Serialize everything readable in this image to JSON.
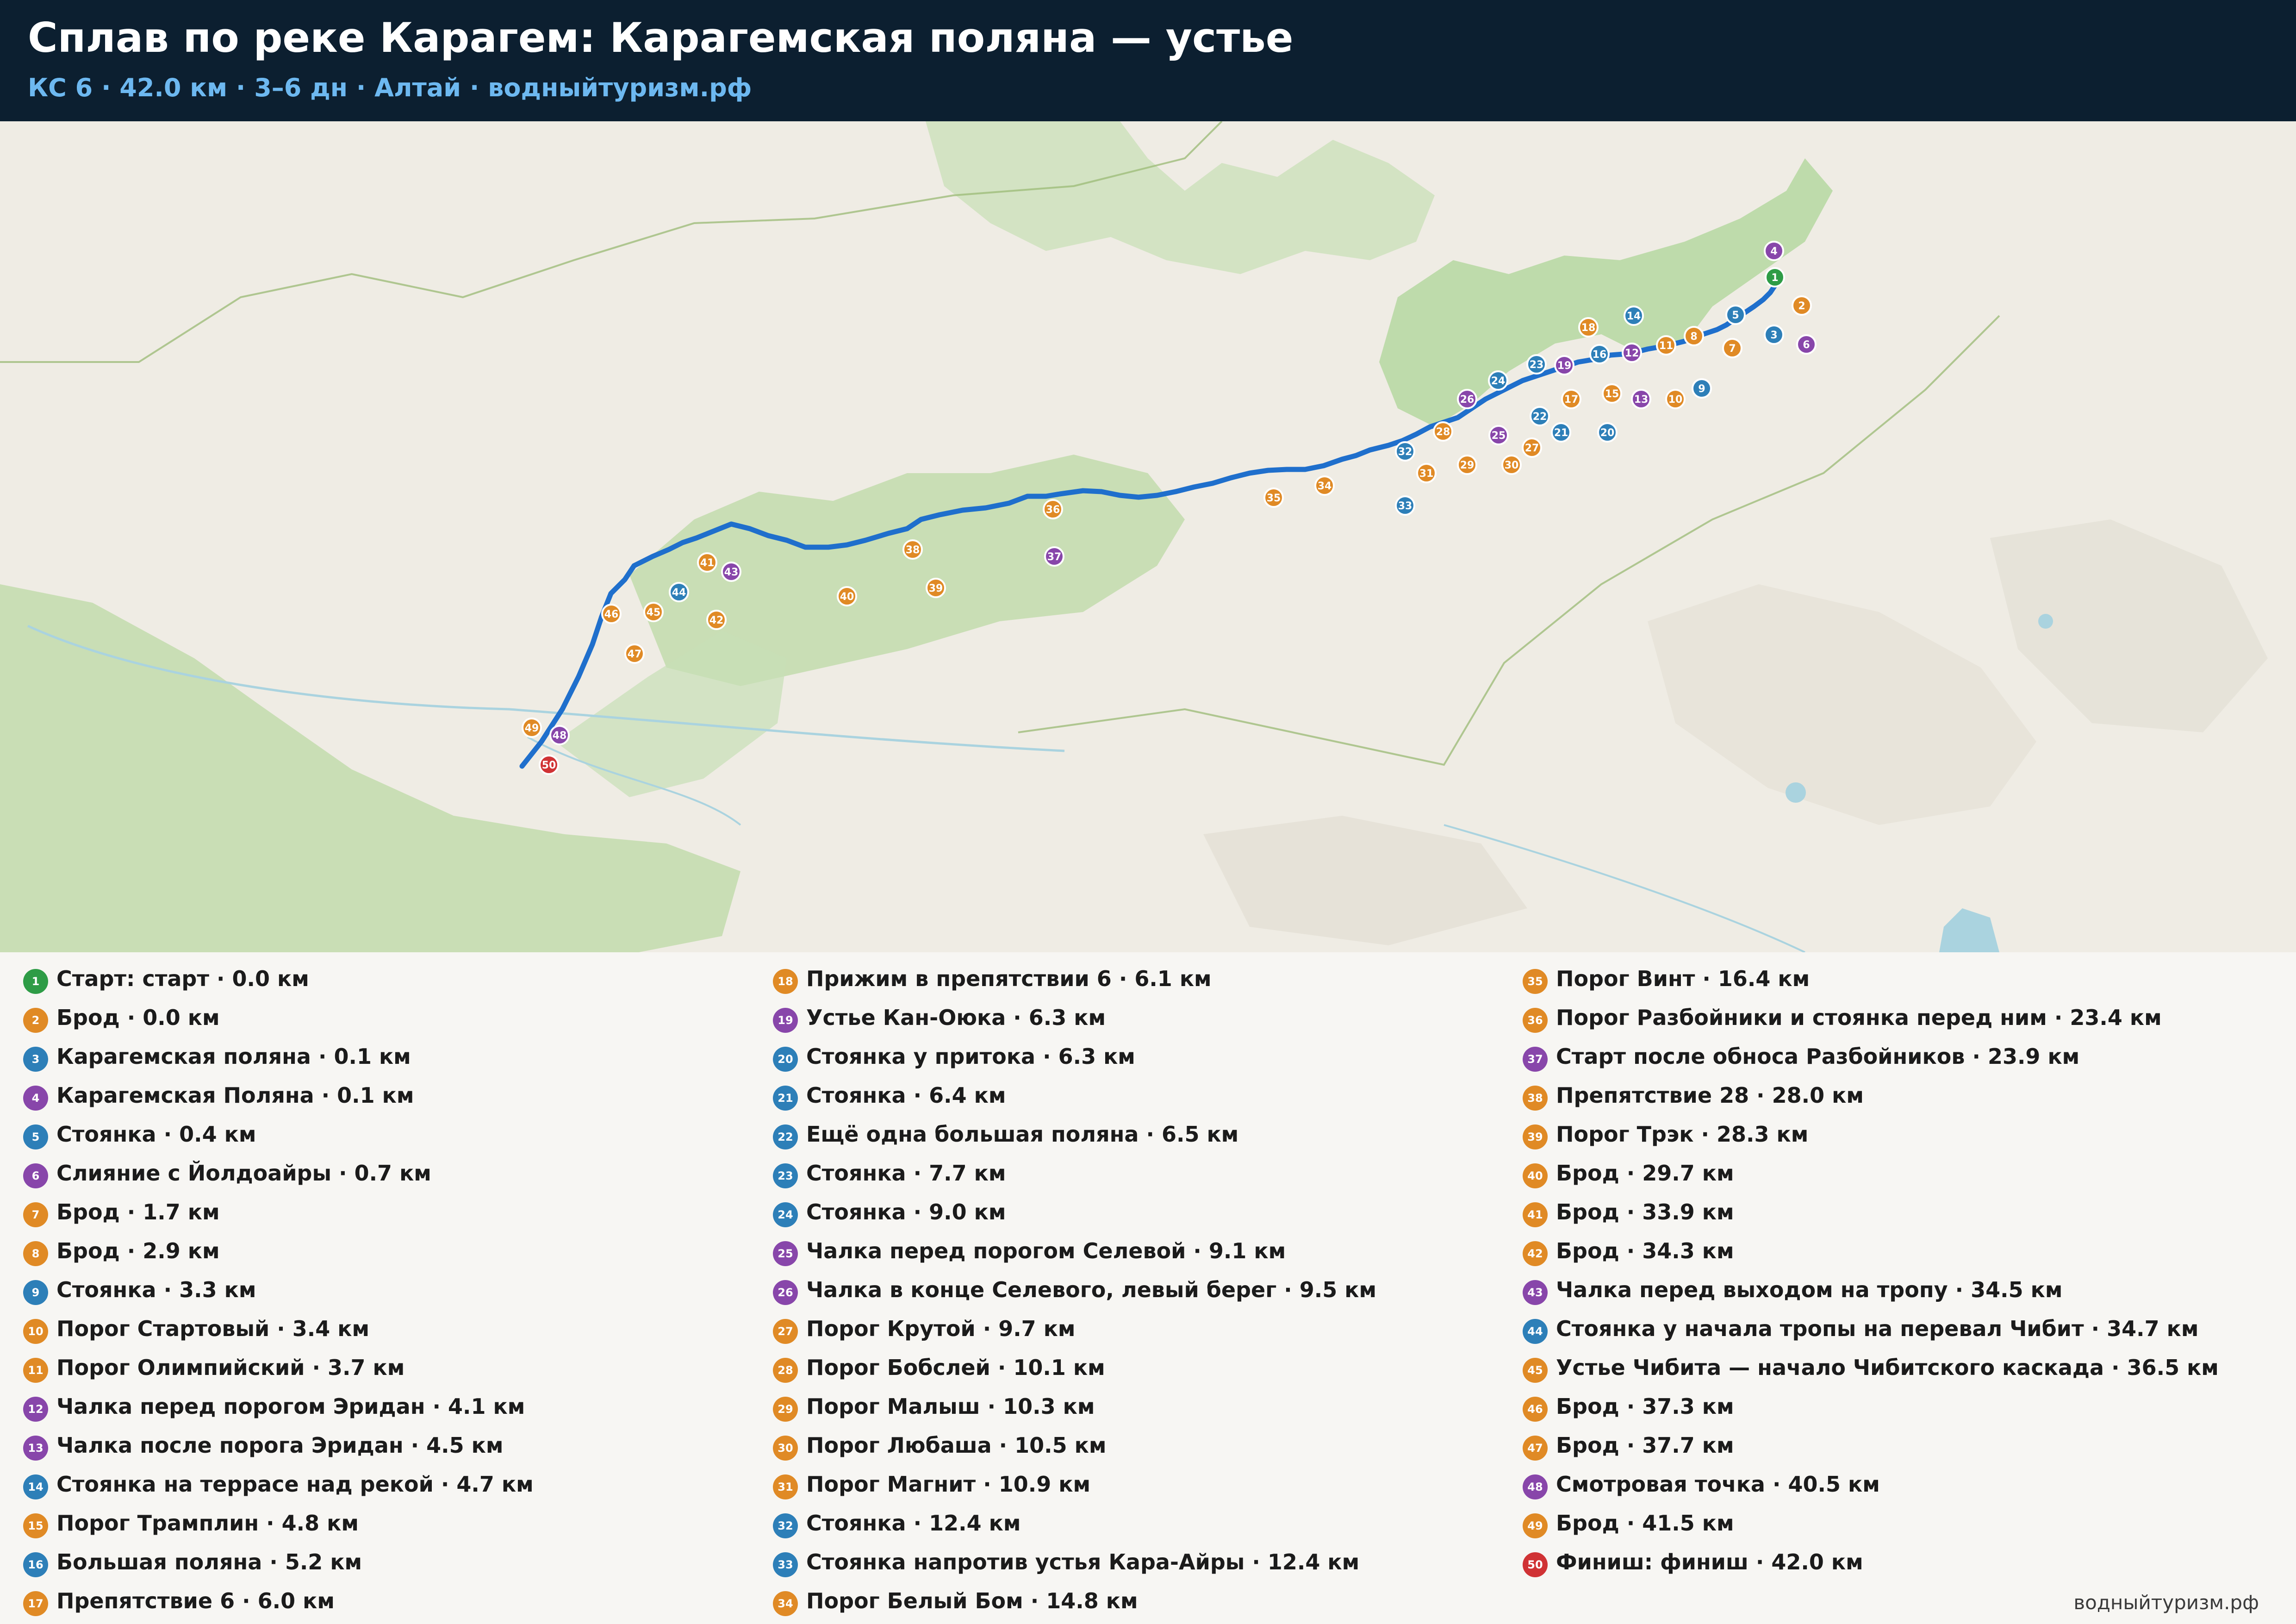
{
  "header": {
    "title": "Сплав по реке Карагем: Карагемская поляна — устье",
    "subtitle": "КС 6  ·  42.0 км  ·  3–6 дн  ·  Алтай  ·  водныйтуризм.рф"
  },
  "colors": {
    "header_bg": "#0c1f30",
    "subtitle": "#6db8f0",
    "route": "#1f6fcc",
    "start": "#2e9c46",
    "ford": "#e08a25",
    "camp": "#2d7fb8",
    "feature": "#8846aa",
    "finish": "#d03234"
  },
  "legend": [
    {
      "n": "1",
      "label": "Старт: старт · 0.0 км",
      "kind": "start"
    },
    {
      "n": "2",
      "label": "Брод · 0.0 км",
      "kind": "ford"
    },
    {
      "n": "3",
      "label": "Карагемская поляна · 0.1 км",
      "kind": "camp"
    },
    {
      "n": "4",
      "label": "Карагемская Поляна · 0.1 км",
      "kind": "feature"
    },
    {
      "n": "5",
      "label": "Стоянка · 0.4 км",
      "kind": "camp"
    },
    {
      "n": "6",
      "label": "Слияние с Йолдоайры · 0.7 км",
      "kind": "feature"
    },
    {
      "n": "7",
      "label": "Брод · 1.7 км",
      "kind": "ford"
    },
    {
      "n": "8",
      "label": "Брод · 2.9 км",
      "kind": "ford"
    },
    {
      "n": "9",
      "label": "Стоянка · 3.3 км",
      "kind": "camp"
    },
    {
      "n": "10",
      "label": "Порог Стартовый · 3.4 км",
      "kind": "ford"
    },
    {
      "n": "11",
      "label": "Порог Олимпийский · 3.7 км",
      "kind": "ford"
    },
    {
      "n": "12",
      "label": "Чалка перед порогом Эридан · 4.1 км",
      "kind": "feature"
    },
    {
      "n": "13",
      "label": "Чалка после порога Эридан · 4.5 км",
      "kind": "feature"
    },
    {
      "n": "14",
      "label": "Стоянка на террасе над рекой · 4.7 км",
      "kind": "camp"
    },
    {
      "n": "15",
      "label": "Порог Трамплин · 4.8 км",
      "kind": "ford"
    },
    {
      "n": "16",
      "label": "Большая поляна · 5.2 км",
      "kind": "camp"
    },
    {
      "n": "17",
      "label": "Препятствие 6 · 6.0 км",
      "kind": "ford"
    },
    {
      "n": "18",
      "label": "Прижим в препятствии 6 · 6.1 км",
      "kind": "ford"
    },
    {
      "n": "19",
      "label": "Устье Кан-Оюка · 6.3 км",
      "kind": "feature"
    },
    {
      "n": "20",
      "label": "Стоянка у притока · 6.3 км",
      "kind": "camp"
    },
    {
      "n": "21",
      "label": "Стоянка · 6.4 км",
      "kind": "camp"
    },
    {
      "n": "22",
      "label": "Ещё одна большая поляна · 6.5 км",
      "kind": "camp"
    },
    {
      "n": "23",
      "label": "Стоянка · 7.7 км",
      "kind": "camp"
    },
    {
      "n": "24",
      "label": "Стоянка · 9.0 км",
      "kind": "camp"
    },
    {
      "n": "25",
      "label": "Чалка перед порогом Селевой · 9.1 км",
      "kind": "feature"
    },
    {
      "n": "26",
      "label": "Чалка в конце Селевого, левый берег · 9.5 км",
      "kind": "feature"
    },
    {
      "n": "27",
      "label": "Порог Крутой · 9.7 км",
      "kind": "ford"
    },
    {
      "n": "28",
      "label": "Порог Бобслей · 10.1 км",
      "kind": "ford"
    },
    {
      "n": "29",
      "label": "Порог Малыш · 10.3 км",
      "kind": "ford"
    },
    {
      "n": "30",
      "label": "Порог Любаша · 10.5 км",
      "kind": "ford"
    },
    {
      "n": "31",
      "label": "Порог Магнит · 10.9 км",
      "kind": "ford"
    },
    {
      "n": "32",
      "label": "Стоянка · 12.4 км",
      "kind": "camp"
    },
    {
      "n": "33",
      "label": "Стоянка напротив устья Кара-Айры · 12.4 км",
      "kind": "camp"
    },
    {
      "n": "34",
      "label": "Порог Белый Бом · 14.8 км",
      "kind": "ford"
    },
    {
      "n": "35",
      "label": "Порог Винт · 16.4 км",
      "kind": "ford"
    },
    {
      "n": "36",
      "label": "Порог Разбойники и стоянка перед ним · 23.4 км",
      "kind": "ford"
    },
    {
      "n": "37",
      "label": "Старт после обноса Разбойников · 23.9 км",
      "kind": "feature"
    },
    {
      "n": "38",
      "label": "Препятствие 28 · 28.0 км",
      "kind": "ford"
    },
    {
      "n": "39",
      "label": "Порог Трэк · 28.3 км",
      "kind": "ford"
    },
    {
      "n": "40",
      "label": "Брод · 29.7 км",
      "kind": "ford"
    },
    {
      "n": "41",
      "label": "Брод · 33.9 км",
      "kind": "ford"
    },
    {
      "n": "42",
      "label": "Брод · 34.3 км",
      "kind": "ford"
    },
    {
      "n": "43",
      "label": "Чалка перед выходом на тропу · 34.5 км",
      "kind": "feature"
    },
    {
      "n": "44",
      "label": "Стоянка у начала тропы на перевал Чибит · 34.7 км",
      "kind": "camp"
    },
    {
      "n": "45",
      "label": "Устье Чибита — начало Чибитского каскада · 36.5 км",
      "kind": "ford"
    },
    {
      "n": "46",
      "label": "Брод · 37.3 км",
      "kind": "ford"
    },
    {
      "n": "47",
      "label": "Брод · 37.7 км",
      "kind": "ford"
    },
    {
      "n": "48",
      "label": "Смотровая точка · 40.5 км",
      "kind": "feature"
    },
    {
      "n": "49",
      "label": "Брод · 41.5 км",
      "kind": "ford"
    },
    {
      "n": "50",
      "label": "Финиш: финиш · 42.0 км",
      "kind": "finish"
    }
  ],
  "footer": "водныйтуризм.рф"
}
